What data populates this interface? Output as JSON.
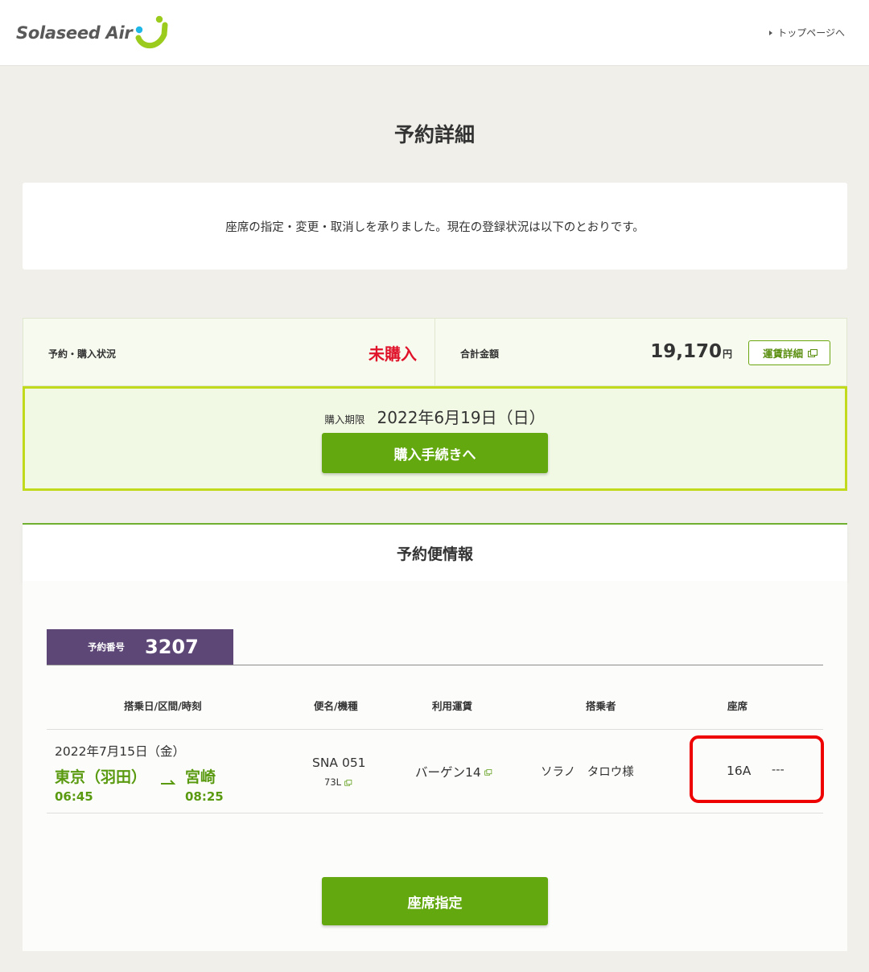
{
  "header": {
    "logo_text": "Solaseed Air",
    "top_link": "トップページへ"
  },
  "page_title": "予約詳細",
  "notice": "座席の指定・変更・取消しを承りました。現在の登録状況は以下のとおりです。",
  "status": {
    "label": "予約・購入状況",
    "value": "未購入",
    "total_label": "合計金額",
    "total_amount": "19,170",
    "currency": "円",
    "fare_detail_button": "運賃詳細"
  },
  "deadline": {
    "label": "購入期限",
    "date": "2022年6月19日（日）",
    "buy_button": "購入手続きへ"
  },
  "flight_section": {
    "title": "予約便情報",
    "reservation_label": "予約番号",
    "reservation_number": "3207",
    "columns": [
      "搭乗日/区間/時刻",
      "便名/機種",
      "利用運賃",
      "搭乗者",
      "座席"
    ],
    "row": {
      "date": "2022年7月15日（金）",
      "from": "東京（羽田）",
      "to": "宮崎",
      "departure": "06:45",
      "arrival": "08:25",
      "flight_number": "SNA 051",
      "aircraft": "73L",
      "fare": "バーゲン14",
      "passenger": "ソラノ　タロウ様",
      "seat": "16A",
      "seat_return": "---"
    },
    "seat_button": "座席指定"
  },
  "colors": {
    "accent_green": "#62a80e",
    "alert_red": "#e0132b",
    "reservation_purple": "#5d4776",
    "highlight_red": "#ee0000"
  }
}
